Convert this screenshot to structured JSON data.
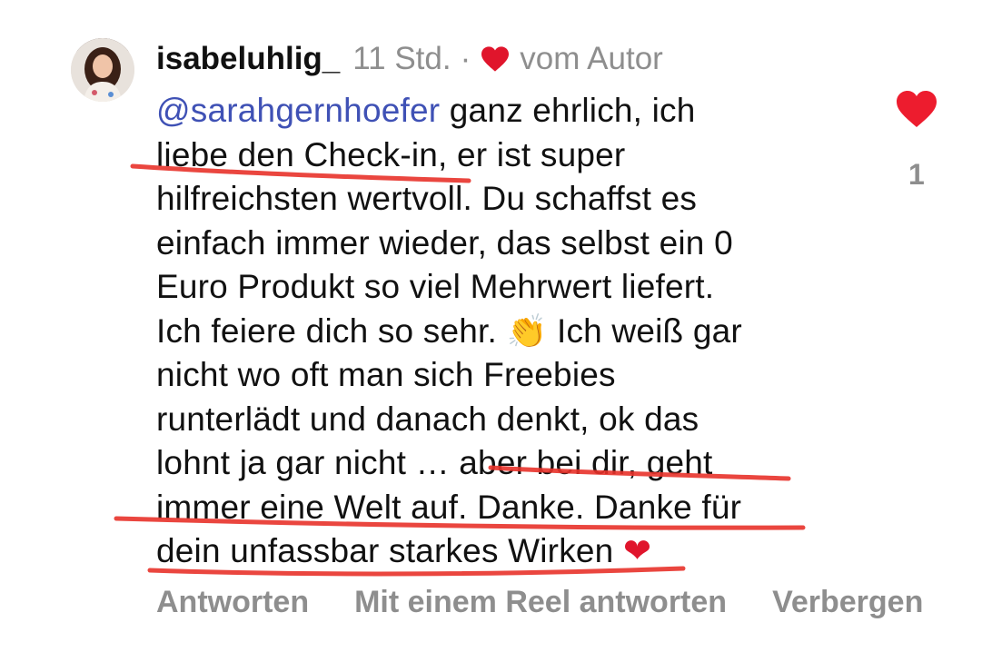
{
  "comment": {
    "username": "isabeluhlig_",
    "time": "11 Std.",
    "separator": "·",
    "liked_by_author": "vom Autor",
    "mention": "@sarahgernhoefer",
    "lines": [
      " ganz ehrlich, ich",
      "liebe den Check-in, er ist super",
      "hilfreichsten wertvoll. Du schaffst es",
      "einfach immer wieder, das selbst ein 0",
      "Euro Produkt so viel Mehrwert liefert.",
      "Ich feiere dich so sehr. ",
      " Ich weiß gar",
      "nicht wo oft man sich Freebies",
      "runterlädt und danach denkt, ok das",
      "lohnt ja gar nicht … aber bei dir, geht",
      "immer eine Welt auf. Danke. Danke für",
      "dein unfassbar starkes Wirken "
    ],
    "clap_emoji": "👏",
    "heart_emoji": "❤",
    "like_count": "1"
  },
  "actions": {
    "reply": "Antworten",
    "reel_reply": "Mit einem Reel antworten",
    "hide": "Verbergen"
  },
  "colors": {
    "mention": "#3f51b5",
    "heart": "#e0152c",
    "annotation": "#e8322a",
    "muted": "#8e8e8e"
  }
}
